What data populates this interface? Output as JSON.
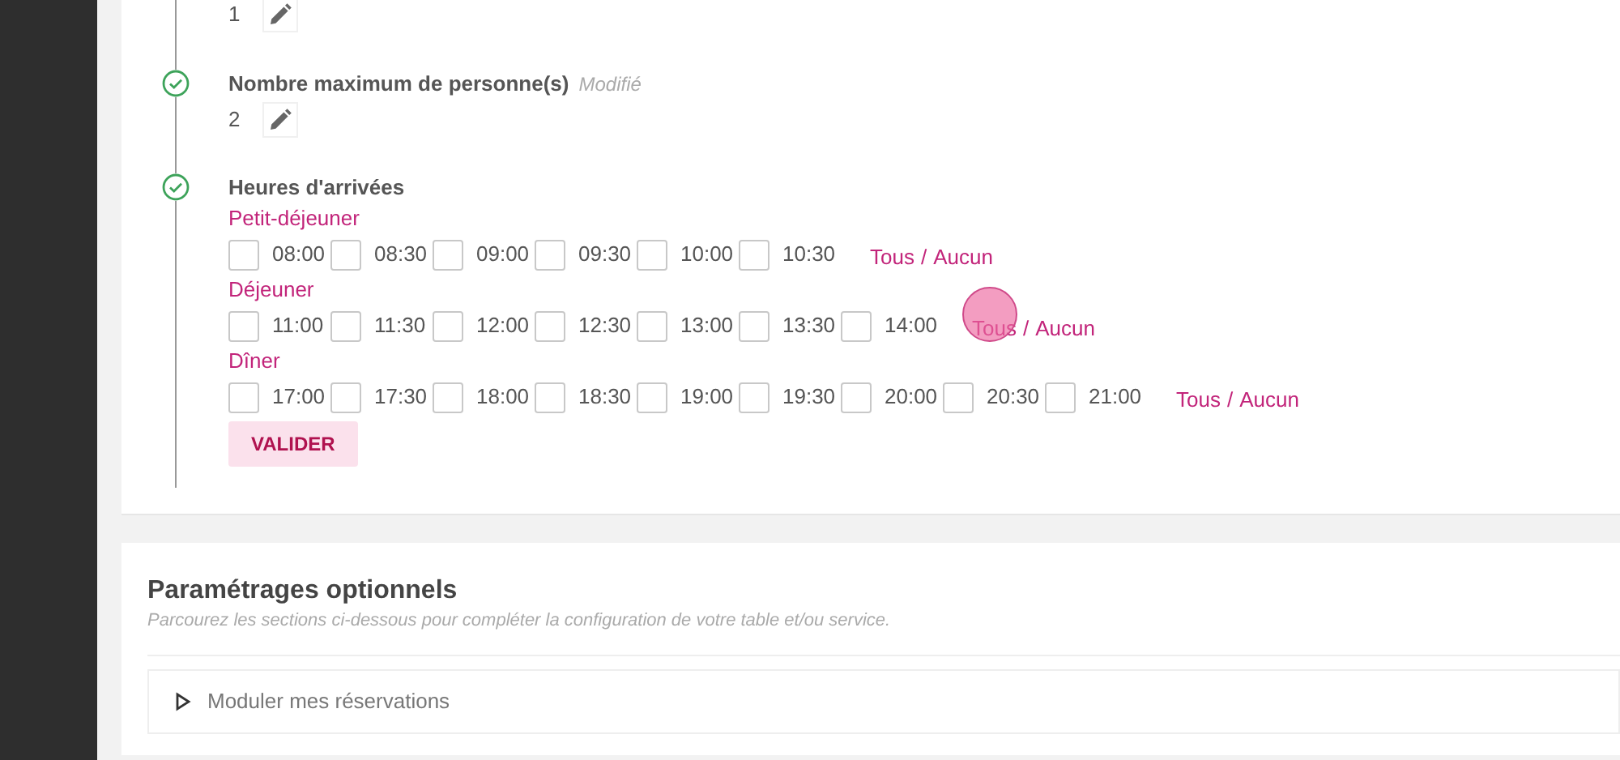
{
  "steps": [
    {
      "value": "1"
    },
    {
      "title": "Nombre maximum de personne(s)",
      "status": "Modifié",
      "completed": true,
      "value": "2"
    },
    {
      "title": "Heures d'arrivées",
      "completed": true,
      "meals": [
        {
          "label": "Petit-déjeuner",
          "times": [
            {
              "time": "08:00",
              "checked": false
            },
            {
              "time": "08:30",
              "checked": false
            },
            {
              "time": "09:00",
              "checked": false
            },
            {
              "time": "09:30",
              "checked": false
            },
            {
              "time": "10:00",
              "checked": false
            },
            {
              "time": "10:30",
              "checked": false
            }
          ],
          "toggle": {
            "all": "Tous",
            "separator": "/",
            "none": "Aucun"
          }
        },
        {
          "label": "Déjeuner",
          "times": [
            {
              "time": "11:00",
              "checked": false
            },
            {
              "time": "11:30",
              "checked": false
            },
            {
              "time": "12:00",
              "checked": false
            },
            {
              "time": "12:30",
              "checked": false
            },
            {
              "time": "13:00",
              "checked": false
            },
            {
              "time": "13:30",
              "checked": false
            },
            {
              "time": "14:00",
              "checked": false
            }
          ],
          "toggle": {
            "all": "Tous",
            "separator": "/",
            "none": "Aucun"
          },
          "click_indicator": true
        },
        {
          "label": "Dîner",
          "times": [
            {
              "time": "17:00",
              "checked": false
            },
            {
              "time": "17:30",
              "checked": false
            },
            {
              "time": "18:00",
              "checked": false
            },
            {
              "time": "18:30",
              "checked": false
            },
            {
              "time": "19:00",
              "checked": false
            },
            {
              "time": "19:30",
              "checked": false
            },
            {
              "time": "20:00",
              "checked": false
            },
            {
              "time": "20:30",
              "checked": false
            },
            {
              "time": "21:00",
              "checked": false
            }
          ],
          "toggle": {
            "all": "Tous",
            "separator": "/",
            "none": "Aucun"
          }
        }
      ],
      "submit": "VALIDER"
    }
  ],
  "optional": {
    "title": "Paramétrages optionnels",
    "subtitle": "Parcourez les sections ci-dessous pour compléter la configuration de votre table et/ou service.",
    "sections": [
      {
        "label": "Moduler mes réservations",
        "expanded": false
      }
    ]
  }
}
